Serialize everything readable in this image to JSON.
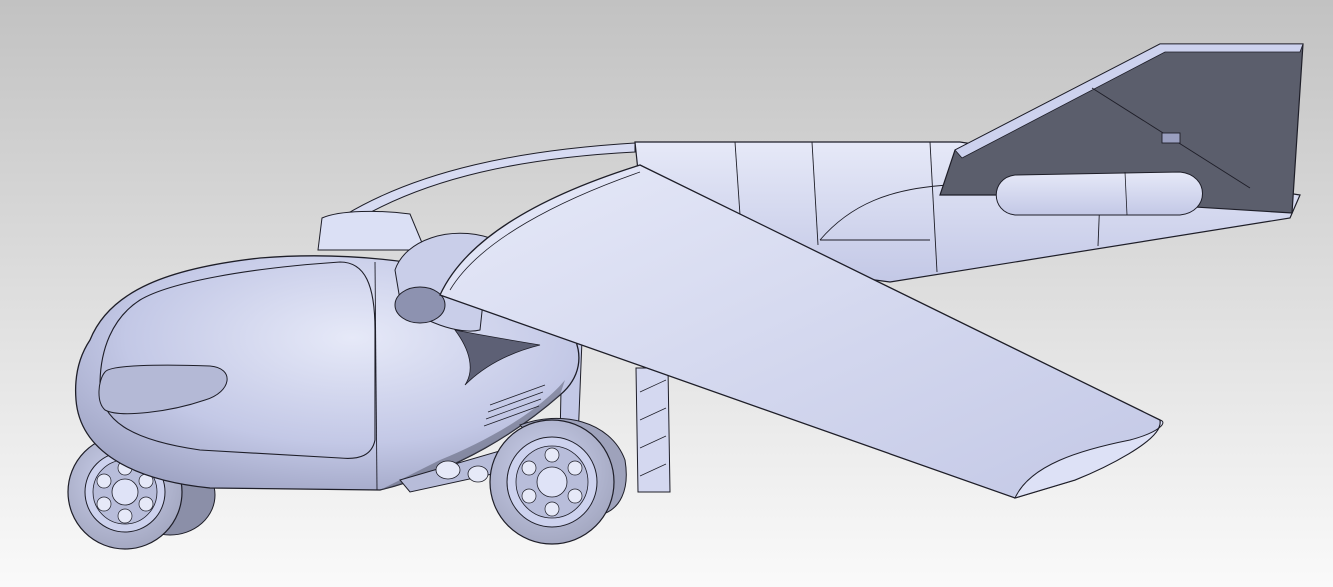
{
  "view": {
    "background_top": "#c2c2c2",
    "background_bottom": "#fafafa"
  },
  "model": {
    "body_light": "#e6e9f8",
    "body_mid": "#c3c8e6",
    "body_dark": "#9a9fbf",
    "edge": "#1e1e28",
    "fin_face": "#5b5e6c",
    "wheel_tire": "#9ea2bb",
    "wheel_hub": "#cdd2ee",
    "underside_dark": "#5d6075"
  }
}
